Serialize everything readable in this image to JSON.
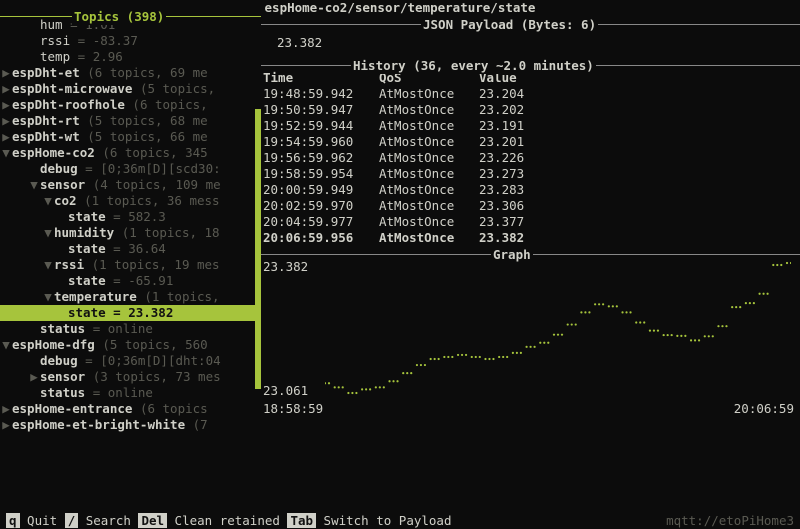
{
  "header": {
    "path": "espHome-co2/sensor/temperature/state"
  },
  "topics": {
    "title": "Topics (398)",
    "rows": [
      {
        "indent": 2,
        "caret": "",
        "name": "hum",
        "meta": "= 1.01",
        "bold": false
      },
      {
        "indent": 2,
        "caret": "",
        "name": "rssi",
        "meta": "= -83.37",
        "bold": false
      },
      {
        "indent": 2,
        "caret": "",
        "name": "temp",
        "meta": "= 2.96",
        "bold": false
      },
      {
        "indent": 0,
        "caret": "▶",
        "name": "espDht-et",
        "meta": "(6 topics, 69 me",
        "bold": true
      },
      {
        "indent": 0,
        "caret": "▶",
        "name": "espDht-microwave",
        "meta": "(5 topics,",
        "bold": true
      },
      {
        "indent": 0,
        "caret": "▶",
        "name": "espDht-roofhole",
        "meta": "(6 topics,",
        "bold": true
      },
      {
        "indent": 0,
        "caret": "▶",
        "name": "espDht-rt",
        "meta": "(5 topics, 68 me",
        "bold": true
      },
      {
        "indent": 0,
        "caret": "▶",
        "name": "espDht-wt",
        "meta": "(5 topics, 66 me",
        "bold": true
      },
      {
        "indent": 0,
        "caret": "▼",
        "name": "espHome-co2",
        "meta": "(6 topics, 345",
        "bold": true
      },
      {
        "indent": 2,
        "caret": "",
        "name": "debug",
        "meta": "= [0;36m[D][scd30:",
        "bold": true
      },
      {
        "indent": 2,
        "caret": "▼",
        "name": "sensor",
        "meta": "(4 topics, 109 me",
        "bold": true
      },
      {
        "indent": 3,
        "caret": "▼",
        "name": "co2",
        "meta": "(1 topics, 36 mess",
        "bold": true
      },
      {
        "indent": 4,
        "caret": "",
        "name": "state",
        "meta": "= 582.3",
        "bold": true
      },
      {
        "indent": 3,
        "caret": "▼",
        "name": "humidity",
        "meta": "(1 topics, 18",
        "bold": true
      },
      {
        "indent": 4,
        "caret": "",
        "name": "state",
        "meta": "= 36.64",
        "bold": true
      },
      {
        "indent": 3,
        "caret": "▼",
        "name": "rssi",
        "meta": "(1 topics, 19 mes",
        "bold": true
      },
      {
        "indent": 4,
        "caret": "",
        "name": "state",
        "meta": "= -65.91",
        "bold": true
      },
      {
        "indent": 3,
        "caret": "▼",
        "name": "temperature",
        "meta": "(1 topics,",
        "bold": true
      },
      {
        "indent": 4,
        "caret": "",
        "name": "state",
        "meta": "= 23.382",
        "bold": true,
        "selected": true
      },
      {
        "indent": 2,
        "caret": "",
        "name": "status",
        "meta": "= online",
        "bold": true
      },
      {
        "indent": 0,
        "caret": "▼",
        "name": "espHome-dfg",
        "meta": "(5 topics, 560",
        "bold": true
      },
      {
        "indent": 2,
        "caret": "",
        "name": "debug",
        "meta": "= [0;36m[D][dht:04",
        "bold": true
      },
      {
        "indent": 2,
        "caret": "▶",
        "name": "sensor",
        "meta": "(3 topics, 73 mes",
        "bold": true
      },
      {
        "indent": 2,
        "caret": "",
        "name": "status",
        "meta": "= online",
        "bold": true
      },
      {
        "indent": 0,
        "caret": "▶",
        "name": "espHome-entrance",
        "meta": "(6 topics",
        "bold": true
      },
      {
        "indent": 0,
        "caret": "▶",
        "name": "espHome-et-bright-white",
        "meta": "(7",
        "bold": true
      }
    ]
  },
  "payload": {
    "title": "JSON Payload (Bytes: 6)",
    "value": "23.382"
  },
  "history": {
    "title": "History (36, every ~2.0 minutes)",
    "cols": {
      "time": "Time",
      "qos": "QoS",
      "value": "Value"
    },
    "rows": [
      {
        "time": "19:48:59.942",
        "qos": "AtMostOnce",
        "value": "23.204"
      },
      {
        "time": "19:50:59.947",
        "qos": "AtMostOnce",
        "value": "23.202"
      },
      {
        "time": "19:52:59.944",
        "qos": "AtMostOnce",
        "value": "23.191"
      },
      {
        "time": "19:54:59.960",
        "qos": "AtMostOnce",
        "value": "23.201"
      },
      {
        "time": "19:56:59.962",
        "qos": "AtMostOnce",
        "value": "23.226"
      },
      {
        "time": "19:58:59.954",
        "qos": "AtMostOnce",
        "value": "23.273"
      },
      {
        "time": "20:00:59.949",
        "qos": "AtMostOnce",
        "value": "23.283"
      },
      {
        "time": "20:02:59.970",
        "qos": "AtMostOnce",
        "value": "23.306"
      },
      {
        "time": "20:04:59.977",
        "qos": "AtMostOnce",
        "value": "23.377"
      },
      {
        "time": "20:06:59.956",
        "qos": "AtMostOnce",
        "value": "23.382",
        "bold": true
      }
    ]
  },
  "graph": {
    "title": "Graph",
    "ymax": "23.382",
    "ymin": "23.061",
    "xmin": "18:58:59",
    "xmax": "20:06:59"
  },
  "chart_data": {
    "type": "line",
    "x": [
      "18:58:59",
      "19:00:59",
      "19:02:59",
      "19:04:59",
      "19:06:59",
      "19:08:59",
      "19:10:59",
      "19:12:59",
      "19:14:59",
      "19:16:59",
      "19:18:59",
      "19:20:59",
      "19:22:59",
      "19:24:59",
      "19:26:59",
      "19:28:59",
      "19:30:59",
      "19:32:59",
      "19:34:59",
      "19:36:59",
      "19:38:59",
      "19:40:59",
      "19:42:59",
      "19:44:59",
      "19:46:59",
      "19:48:59",
      "19:50:59",
      "19:52:59",
      "19:54:59",
      "19:56:59",
      "19:58:59",
      "20:00:59",
      "20:02:59",
      "20:04:59",
      "20:06:59"
    ],
    "values": [
      23.085,
      23.075,
      23.061,
      23.07,
      23.075,
      23.09,
      23.11,
      23.13,
      23.145,
      23.15,
      23.155,
      23.15,
      23.145,
      23.15,
      23.16,
      23.175,
      23.185,
      23.205,
      23.23,
      23.26,
      23.28,
      23.275,
      23.26,
      23.235,
      23.215,
      23.204,
      23.202,
      23.191,
      23.201,
      23.226,
      23.273,
      23.283,
      23.306,
      23.377,
      23.382
    ],
    "ylim": [
      23.061,
      23.382
    ],
    "xlabel": "",
    "ylabel": "",
    "title": ""
  },
  "footer": {
    "items": [
      {
        "key": "q",
        "label": "Quit"
      },
      {
        "key": "/",
        "label": "Search"
      },
      {
        "key": "Del",
        "label": "Clean retained"
      },
      {
        "key": "Tab",
        "label": "Switch to Payload"
      }
    ],
    "broker": "mqtt://etoPiHome3"
  }
}
